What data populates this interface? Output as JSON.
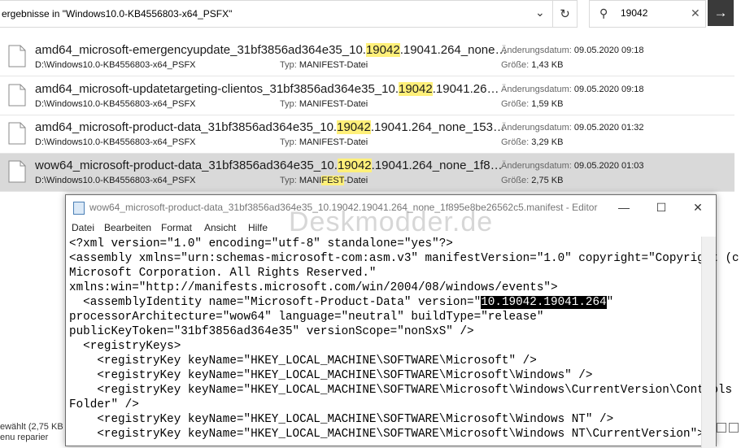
{
  "explorer": {
    "address_text": "ergebnisse in \"Windows10.0-KB4556803-x64_PSFX\"",
    "search_value": "19042",
    "results": [
      {
        "name_pre": "amd64_microsoft-emergencyupdate_31bf3856ad364e35_10.",
        "name_hl": "19042",
        "name_post": ".19041.264_none…",
        "path": "D:\\Windows10.0-KB4556803-x64_PSFX",
        "type_label": "Typ:",
        "type_pre": "MANIFEST-Datei",
        "type_hl": "",
        "type_post": "",
        "date_label": "Änderungsdatum:",
        "date": "09.05.2020 09:18",
        "size_label": "Größe:",
        "size": "1,43 KB"
      },
      {
        "name_pre": "amd64_microsoft-updatetargeting-clientos_31bf3856ad364e35_10.",
        "name_hl": "19042",
        "name_post": ".19041.26…",
        "path": "D:\\Windows10.0-KB4556803-x64_PSFX",
        "type_label": "Typ:",
        "type_pre": "MANIFEST-Datei",
        "type_hl": "",
        "type_post": "",
        "date_label": "Änderungsdatum:",
        "date": "09.05.2020 09:18",
        "size_label": "Größe:",
        "size": "1,59 KB"
      },
      {
        "name_pre": "amd64_microsoft-product-data_31bf3856ad364e35_10.",
        "name_hl": "19042",
        "name_post": ".19041.264_none_153…",
        "path": "D:\\Windows10.0-KB4556803-x64_PSFX",
        "type_label": "Typ:",
        "type_pre": "MANIFEST-Datei",
        "type_hl": "",
        "type_post": "",
        "date_label": "Änderungsdatum:",
        "date": "09.05.2020 01:32",
        "size_label": "Größe:",
        "size": "3,29 KB"
      },
      {
        "name_pre": "wow64_microsoft-product-data_31bf3856ad364e35_10.",
        "name_hl": "19042",
        "name_post": ".19041.264_none_1f8…",
        "path": "D:\\Windows10.0-KB4556803-x64_PSFX",
        "type_label": "Typ:",
        "type_pre": "MANI",
        "type_hl": "FEST",
        "type_post": "-Datei",
        "date_label": "Änderungsdatum:",
        "date": "09.05.2020 01:03",
        "size_label": "Größe:",
        "size": "2,75 KB"
      }
    ],
    "status_line1": "ewählt (2,75 KB",
    "status_line2": "enu reparier"
  },
  "notepad": {
    "title": "wow64_microsoft-product-data_31bf3856ad364e35_10.19042.19041.264_none_1f895e8be26562c5.manifest - Editor",
    "menu": [
      "Datei",
      "Bearbeiten",
      "Format",
      "Ansicht",
      "Hilfe"
    ],
    "watermark": "Deskmodder.de",
    "lines_before": [
      "<?xml version=\"1.0\" encoding=\"utf-8\" standalone=\"yes\"?>",
      "<assembly xmlns=\"urn:schemas-microsoft-com:asm.v3\" manifestVersion=\"1.0\" copyright=\"Copyright (c)",
      "Microsoft Corporation. All Rights Reserved.\"",
      "xmlns:win=\"http://manifests.microsoft.com/win/2004/08/windows/events\">"
    ],
    "version_line_pre": "  <assemblyIdentity name=\"Microsoft-Product-Data\" version=\"",
    "version_selected": "10.19042.19041.264",
    "version_line_post": "\"",
    "lines_after": [
      "processorArchitecture=\"wow64\" language=\"neutral\" buildType=\"release\"",
      "publicKeyToken=\"31bf3856ad364e35\" versionScope=\"nonSxS\" />",
      "  <registryKeys>",
      "    <registryKey keyName=\"HKEY_LOCAL_MACHINE\\SOFTWARE\\Microsoft\" />",
      "    <registryKey keyName=\"HKEY_LOCAL_MACHINE\\SOFTWARE\\Microsoft\\Windows\" />",
      "    <registryKey keyName=\"HKEY_LOCAL_MACHINE\\SOFTWARE\\Microsoft\\Windows\\CurrentVersion\\Controls",
      "Folder\" />",
      "    <registryKey keyName=\"HKEY_LOCAL_MACHINE\\SOFTWARE\\Microsoft\\Windows NT\" />",
      "    <registryKey keyName=\"HKEY_LOCAL_MACHINE\\SOFTWARE\\Microsoft\\Windows NT\\CurrentVersion\">"
    ]
  }
}
